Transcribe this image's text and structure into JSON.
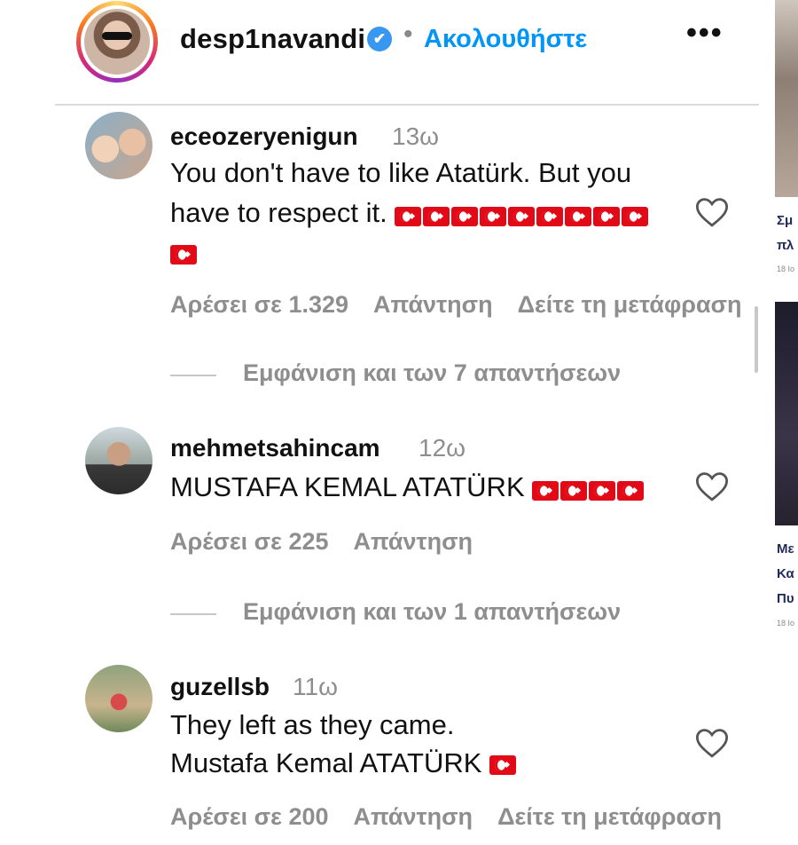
{
  "header": {
    "username": "desp1navandi",
    "verified_mark": "✔",
    "separator": "•",
    "follow_label": "Ακολουθήστε",
    "more_label": "•••"
  },
  "comments": [
    {
      "username": "eceozeryenigun",
      "time": "13ω",
      "text_line1": "You don't have to like Atatürk. But you",
      "text_line2": "have to respect it.",
      "likes": "Αρέσει σε 1.329",
      "reply_label": "Απάντηση",
      "translate_label": "Δείτε τη μετάφραση",
      "view_replies": "Εμφάνιση και των 7 απαντήσεων"
    },
    {
      "username": "mehmetsahincam",
      "time": "12ω",
      "text_line1": "MUSTAFA KEMAL ATATÜRK",
      "likes": "Αρέσει σε 225",
      "reply_label": "Απάντηση",
      "view_replies": "Εμφάνιση και των 1 απαντήσεων"
    },
    {
      "username": "guzellsb",
      "time": "11ω",
      "text_line1": "They left as they came.",
      "text_line2": "Mustafa Kemal ATATÜRK",
      "likes": "Αρέσει σε 200",
      "reply_label": "Απάντηση",
      "translate_label": "Δείτε τη μετάφραση"
    }
  ],
  "sidebar": {
    "article1_line1": "Σμ",
    "article1_line2": "πλ",
    "article1_date": "18 Ιο",
    "article2_line1": "Με",
    "article2_line2": "Κα",
    "article2_line3": "Πυ",
    "article2_date": "18 Ιο"
  },
  "icons": {
    "heart": "heart-icon",
    "flag": "turkey-flag-emoji"
  },
  "colors": {
    "follow": "#0095f6",
    "verified": "#3897f0",
    "flag": "#e30a17"
  }
}
